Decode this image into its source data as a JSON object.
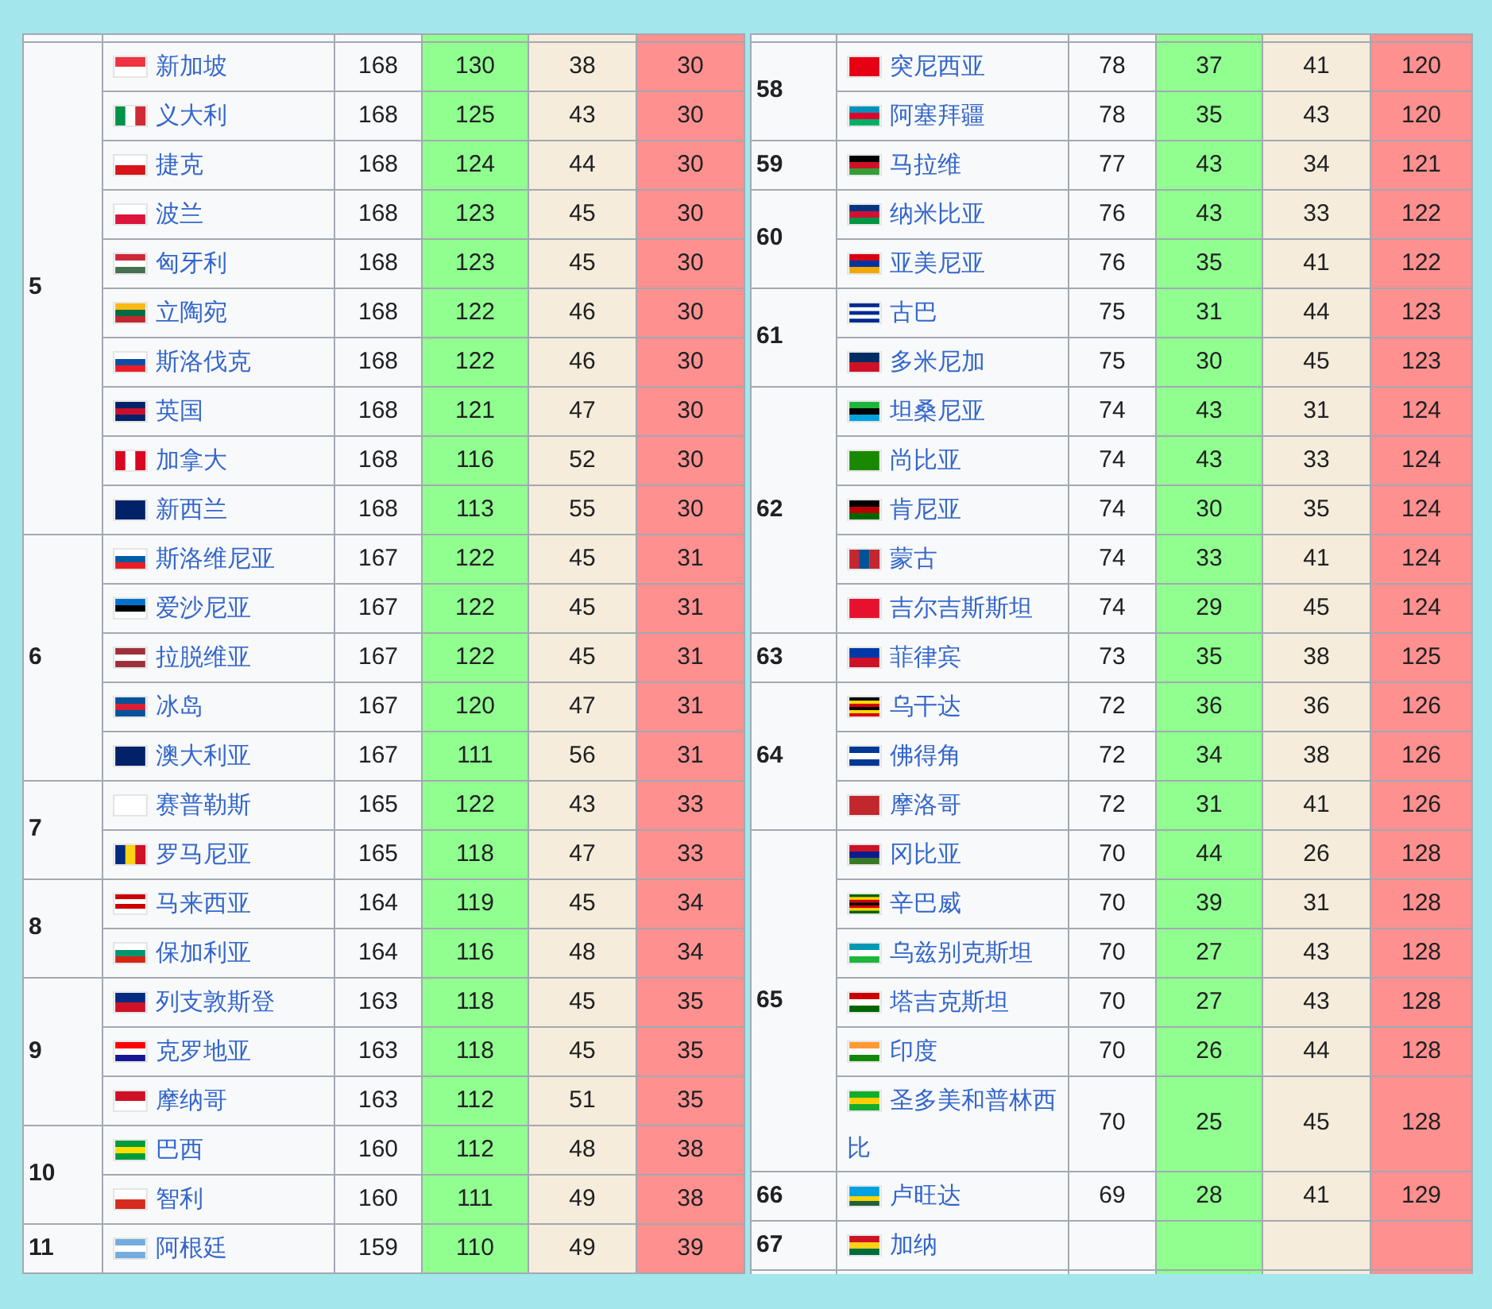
{
  "tables": [
    {
      "groups": [
        {
          "rank": "5",
          "countries": [
            {
              "name": "新加坡",
              "column_3": "168",
              "column_4": "130",
              "column_5": "38",
              "column_6": "30"
            },
            {
              "name": "义大利",
              "column_3": "168",
              "column_4": "125",
              "column_5": "43",
              "column_6": "30"
            },
            {
              "name": "捷克",
              "column_3": "168",
              "column_4": "124",
              "column_5": "44",
              "column_6": "30"
            },
            {
              "name": "波兰",
              "column_3": "168",
              "column_4": "123",
              "column_5": "45",
              "column_6": "30"
            },
            {
              "name": "匈牙利",
              "column_3": "168",
              "column_4": "123",
              "column_5": "45",
              "column_6": "30"
            },
            {
              "name": "立陶宛",
              "column_3": "168",
              "column_4": "122",
              "column_5": "46",
              "column_6": "30"
            },
            {
              "name": "斯洛伐克",
              "column_3": "168",
              "column_4": "122",
              "column_5": "46",
              "column_6": "30"
            },
            {
              "name": "英国",
              "column_3": "168",
              "column_4": "121",
              "column_5": "47",
              "column_6": "30"
            },
            {
              "name": "加拿大",
              "column_3": "168",
              "column_4": "116",
              "column_5": "52",
              "column_6": "30"
            },
            {
              "name": "新西兰",
              "column_3": "168",
              "column_4": "113",
              "column_5": "55",
              "column_6": "30"
            }
          ]
        },
        {
          "rank": "6",
          "countries": [
            {
              "name": "斯洛维尼亚",
              "column_3": "167",
              "column_4": "122",
              "column_5": "45",
              "column_6": "31"
            },
            {
              "name": "爱沙尼亚",
              "column_3": "167",
              "column_4": "122",
              "column_5": "45",
              "column_6": "31"
            },
            {
              "name": "拉脱维亚",
              "column_3": "167",
              "column_4": "122",
              "column_5": "45",
              "column_6": "31"
            },
            {
              "name": "冰岛",
              "column_3": "167",
              "column_4": "120",
              "column_5": "47",
              "column_6": "31"
            },
            {
              "name": "澳大利亚",
              "column_3": "167",
              "column_4": "111",
              "column_5": "56",
              "column_6": "31"
            }
          ]
        },
        {
          "rank": "7",
          "countries": [
            {
              "name": "赛普勒斯",
              "column_3": "165",
              "column_4": "122",
              "column_5": "43",
              "column_6": "33"
            },
            {
              "name": "罗马尼亚",
              "column_3": "165",
              "column_4": "118",
              "column_5": "47",
              "column_6": "33"
            }
          ]
        },
        {
          "rank": "8",
          "countries": [
            {
              "name": "马来西亚",
              "column_3": "164",
              "column_4": "119",
              "column_5": "45",
              "column_6": "34"
            },
            {
              "name": "保加利亚",
              "column_3": "164",
              "column_4": "116",
              "column_5": "48",
              "column_6": "34"
            }
          ]
        },
        {
          "rank": "9",
          "countries": [
            {
              "name": "列支敦斯登",
              "column_3": "163",
              "column_4": "118",
              "column_5": "45",
              "column_6": "35"
            },
            {
              "name": "克罗地亚",
              "column_3": "163",
              "column_4": "118",
              "column_5": "45",
              "column_6": "35"
            },
            {
              "name": "摩纳哥",
              "column_3": "163",
              "column_4": "112",
              "column_5": "51",
              "column_6": "35"
            }
          ]
        },
        {
          "rank": "10",
          "countries": [
            {
              "name": "巴西",
              "column_3": "160",
              "column_4": "112",
              "column_5": "48",
              "column_6": "38"
            },
            {
              "name": "智利",
              "column_3": "160",
              "column_4": "111",
              "column_5": "49",
              "column_6": "38"
            }
          ]
        },
        {
          "rank": "11",
          "countries": [
            {
              "name": "阿根廷",
              "column_3": "159",
              "column_4": "110",
              "column_5": "49",
              "column_6": "39"
            }
          ]
        }
      ]
    },
    {
      "groups": [
        {
          "rank": "58",
          "countries": [
            {
              "name": "突尼西亚",
              "column_3": "78",
              "column_4": "37",
              "column_5": "41",
              "column_6": "120"
            },
            {
              "name": "阿塞拜疆",
              "column_3": "78",
              "column_4": "35",
              "column_5": "43",
              "column_6": "120"
            }
          ]
        },
        {
          "rank": "59",
          "countries": [
            {
              "name": "马拉维",
              "column_3": "77",
              "column_4": "43",
              "column_5": "34",
              "column_6": "121"
            }
          ]
        },
        {
          "rank": "60",
          "countries": [
            {
              "name": "纳米比亚",
              "column_3": "76",
              "column_4": "43",
              "column_5": "33",
              "column_6": "122"
            },
            {
              "name": "亚美尼亚",
              "column_3": "76",
              "column_4": "35",
              "column_5": "41",
              "column_6": "122"
            }
          ]
        },
        {
          "rank": "61",
          "countries": [
            {
              "name": "古巴",
              "column_3": "75",
              "column_4": "31",
              "column_5": "44",
              "column_6": "123"
            },
            {
              "name": "多米尼加",
              "column_3": "75",
              "column_4": "30",
              "column_5": "45",
              "column_6": "123"
            }
          ]
        },
        {
          "rank": "62",
          "countries": [
            {
              "name": "坦桑尼亚",
              "column_3": "74",
              "column_4": "43",
              "column_5": "31",
              "column_6": "124"
            },
            {
              "name": "尚比亚",
              "column_3": "74",
              "column_4": "43",
              "column_5": "33",
              "column_6": "124"
            },
            {
              "name": "肯尼亚",
              "column_3": "74",
              "column_4": "30",
              "column_5": "35",
              "column_6": "124"
            },
            {
              "name": "蒙古",
              "column_3": "74",
              "column_4": "33",
              "column_5": "41",
              "column_6": "124"
            },
            {
              "name": "吉尔吉斯斯坦",
              "column_3": "74",
              "column_4": "29",
              "column_5": "45",
              "column_6": "124"
            }
          ]
        },
        {
          "rank": "63",
          "countries": [
            {
              "name": "菲律宾",
              "column_3": "73",
              "column_4": "35",
              "column_5": "38",
              "column_6": "125"
            }
          ]
        },
        {
          "rank": "64",
          "countries": [
            {
              "name": "乌干达",
              "column_3": "72",
              "column_4": "36",
              "column_5": "36",
              "column_6": "126"
            },
            {
              "name": "佛得角",
              "column_3": "72",
              "column_4": "34",
              "column_5": "38",
              "column_6": "126"
            },
            {
              "name": "摩洛哥",
              "column_3": "72",
              "column_4": "31",
              "column_5": "41",
              "column_6": "126"
            }
          ]
        },
        {
          "rank": "65",
          "countries": [
            {
              "name": "冈比亚",
              "column_3": "70",
              "column_4": "44",
              "column_5": "26",
              "column_6": "128"
            },
            {
              "name": "辛巴威",
              "column_3": "70",
              "column_4": "39",
              "column_5": "31",
              "column_6": "128"
            },
            {
              "name": "乌兹别克斯坦",
              "column_3": "70",
              "column_4": "27",
              "column_5": "43",
              "column_6": "128"
            },
            {
              "name": "塔吉克斯坦",
              "column_3": "70",
              "column_4": "27",
              "column_5": "43",
              "column_6": "128"
            },
            {
              "name": "印度",
              "column_3": "70",
              "column_4": "26",
              "column_5": "44",
              "column_6": "128"
            },
            {
              "name": "圣多美和普林西比",
              "column_3": "70",
              "column_4": "25",
              "column_5": "45",
              "column_6": "128"
            }
          ]
        },
        {
          "rank": "66",
          "countries": [
            {
              "name": "卢旺达",
              "column_3": "69",
              "column_4": "28",
              "column_5": "41",
              "column_6": "129"
            }
          ]
        },
        {
          "rank": "67",
          "countries": [
            {
              "name": "加纳"
            }
          ]
        }
      ]
    }
  ]
}
